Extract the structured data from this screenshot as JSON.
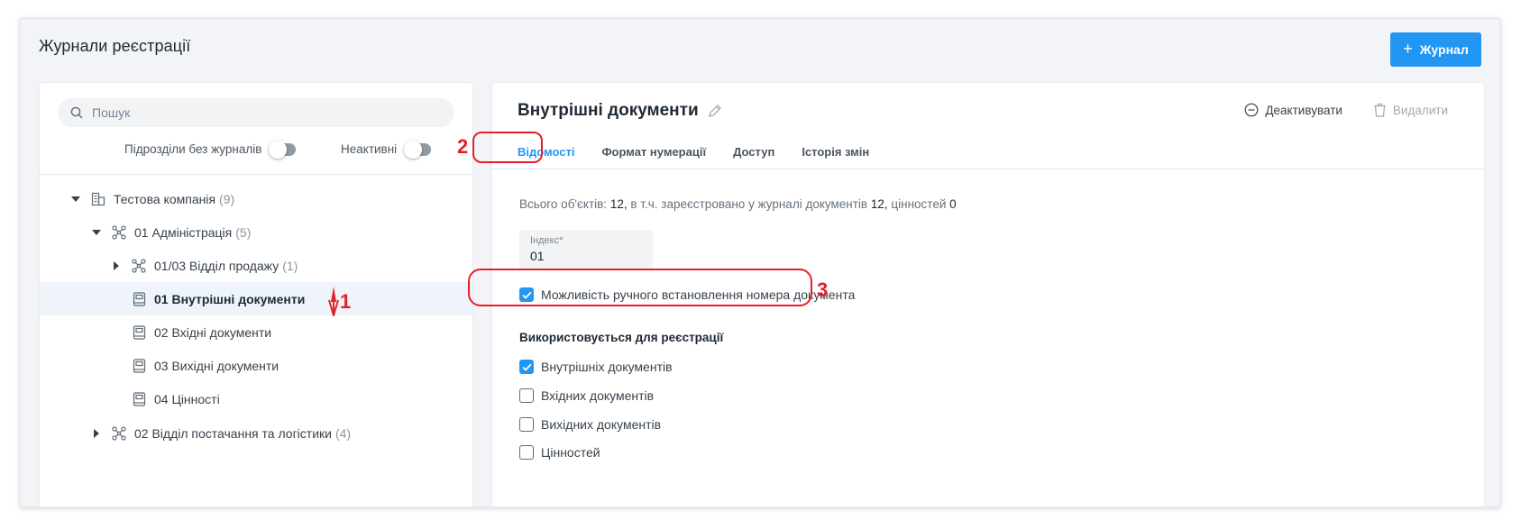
{
  "header": {
    "title": "Журнали реєстрації",
    "add_button": "Журнал"
  },
  "search": {
    "placeholder": "Пошук"
  },
  "filters": {
    "no_journals": "Підрозділи без журналів",
    "inactive": "Неактивні"
  },
  "tree": {
    "company": {
      "label": "Тестова компанія",
      "count": "(9)"
    },
    "admin": {
      "label": "01 Адміністрація",
      "count": "(5)"
    },
    "sales": {
      "label": "01/03 Відділ продажу",
      "count": "(1)"
    },
    "items": [
      {
        "label": "01 Внутрішні документи"
      },
      {
        "label": "02 Вхідні документи"
      },
      {
        "label": "03 Вихідні документи"
      },
      {
        "label": "04 Цінності"
      }
    ],
    "supply": {
      "label": "02 Відділ постачання та логістики",
      "count": "(4)"
    }
  },
  "detail": {
    "title": "Внутрішні документи",
    "deactivate": "Деактивувати",
    "delete": "Видалити",
    "tabs": [
      {
        "label": "Відомості"
      },
      {
        "label": "Формат нумерації"
      },
      {
        "label": "Доступ"
      },
      {
        "label": "Історія змін"
      }
    ],
    "stats": {
      "p1": "Всього об'єктів:",
      "total": "12,",
      "p2": "в т.ч. зареєстровано у журналі документів",
      "docs": "12,",
      "p3": "цінностей",
      "values": "0"
    },
    "index": {
      "label": "Індекс*",
      "value": "01"
    },
    "manual_number": {
      "label": "Можливість ручного встановлення номера документа",
      "checked": true
    },
    "used_for": {
      "heading": "Використовується для реєстрації",
      "options": [
        {
          "label": "Внутрішніх документів",
          "checked": true
        },
        {
          "label": "Вхідних документів",
          "checked": false
        },
        {
          "label": "Вихідних документів",
          "checked": false
        },
        {
          "label": "Цінностей",
          "checked": false
        }
      ]
    }
  },
  "annotations": {
    "n1": "1",
    "n2": "2",
    "n3": "3"
  },
  "colors": {
    "accent": "#2196f3",
    "annotation": "#e3212b"
  }
}
